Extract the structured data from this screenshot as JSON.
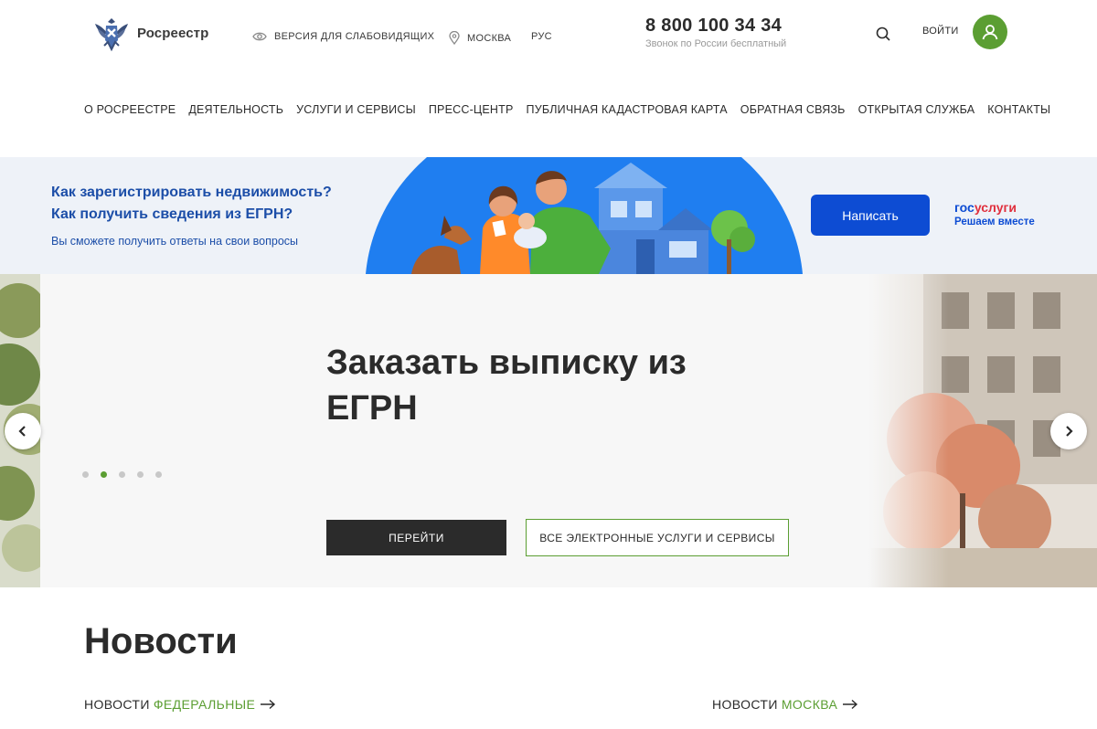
{
  "header": {
    "logo_text": "Росреестр",
    "accessibility_label": "ВЕРСИЯ ДЛЯ СЛАБОВИДЯЩИХ",
    "region_label": "МОСКВА",
    "language_label": "РУС",
    "phone_number": "8 800 100 34 34",
    "phone_note": "Звонок по России бесплатный",
    "login_label": "ВОЙТИ"
  },
  "nav": {
    "items": [
      "О РОСРЕЕСТРЕ",
      "ДЕЯТЕЛЬНОСТЬ",
      "УСЛУГИ И СЕРВИСЫ",
      "ПРЕСС-ЦЕНТР",
      "ПУБЛИЧНАЯ КАДАСТРОВАЯ КАРТА",
      "ОБРАТНАЯ СВЯЗЬ",
      "ОТКРЫТАЯ СЛУЖБА",
      "КОНТАКТЫ"
    ]
  },
  "banner": {
    "question_1": "Как зарегистрировать недвижимость?",
    "question_2": "Как получить сведения из ЕГРН?",
    "subtitle": "Вы сможете получить ответы на свои вопросы",
    "button_label": "Написать",
    "gos_part1": "гос",
    "gos_part2": "услуги",
    "gos_tagline": "Решаем вместе"
  },
  "hero": {
    "title": "Заказать выписку из ЕГРН",
    "go_button": "ПЕРЕЙТИ",
    "services_button": "ВСЕ ЭЛЕКТРОННЫЕ УСЛУГИ И СЕРВИСЫ",
    "slide_count": 5,
    "active_slide": 2
  },
  "news": {
    "title": "Новости",
    "federal_prefix": "НОВОСТИ",
    "federal_accent": "ФЕДЕРАЛЬНЫЕ",
    "moscow_prefix": "НОВОСТИ",
    "moscow_accent": "МОСКВА"
  },
  "colors": {
    "accent_green": "#5b9e32",
    "gos_blue": "#0d4cd3",
    "banner_text_blue": "#1c4ea8"
  }
}
